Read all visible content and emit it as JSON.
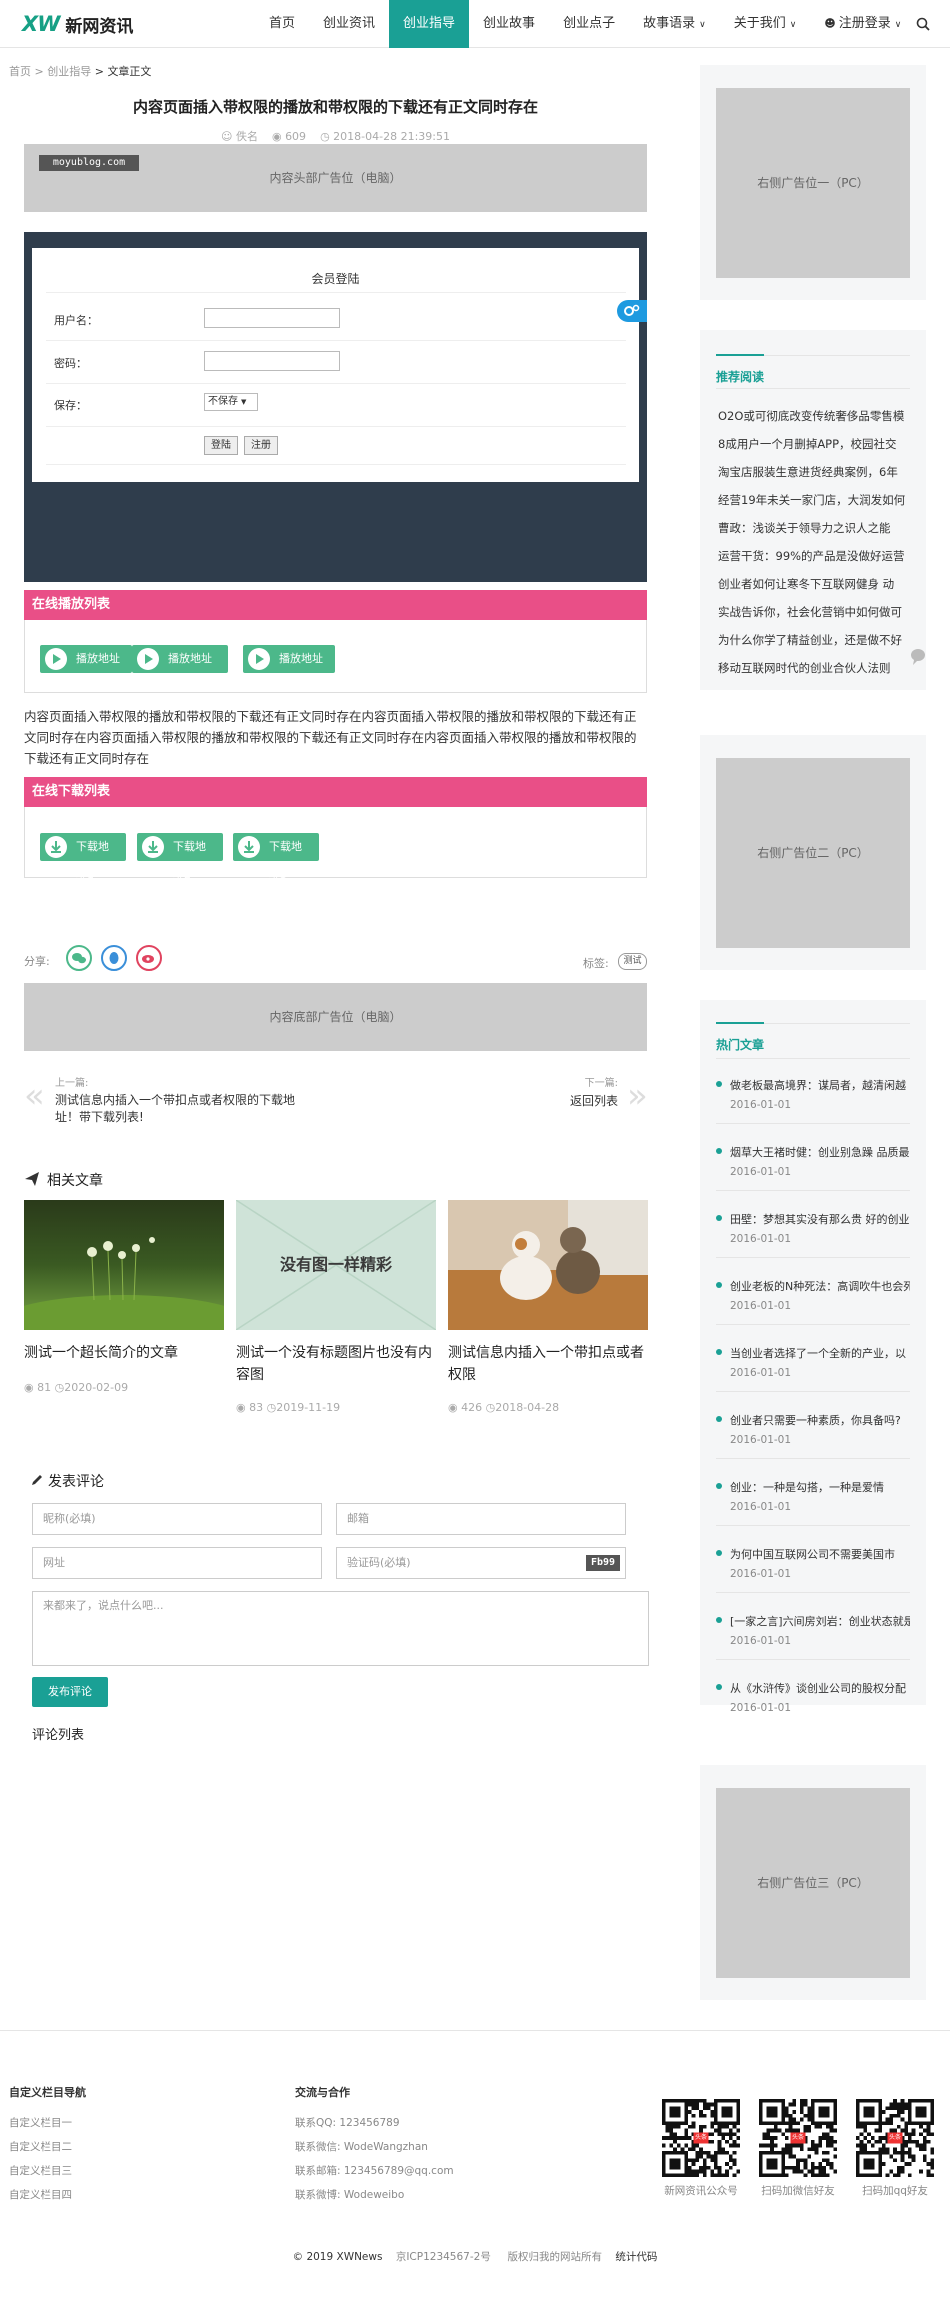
{
  "site": {
    "logo_mark": "XW",
    "logo_text": "新网资讯"
  },
  "nav": [
    {
      "label": "首页"
    },
    {
      "label": "创业资讯"
    },
    {
      "label": "创业指导",
      "active": true
    },
    {
      "label": "创业故事"
    },
    {
      "label": "创业点子"
    },
    {
      "label": "故事语录",
      "has_dropdown": true
    },
    {
      "label": "关于我们",
      "has_dropdown": true
    },
    {
      "label": "注册登录",
      "has_dropdown": true,
      "icon": "user-icon"
    }
  ],
  "breadcrumb": {
    "home": "首页",
    "sep": ">",
    "category": "创业指导",
    "current": "文章正文"
  },
  "article": {
    "title": "内容页面插入带权限的播放和带权限的下载还有正文同时存在",
    "author": "佚名",
    "views": "609",
    "date": "2018-04-28 21:39:51",
    "body": "内容页面插入带权限的播放和带权限的下载还有正文同时存在内容页面插入带权限的播放和带权限的下载还有正文同时存在内容页面插入带权限的播放和带权限的下载还有正文同时存在内容页面插入带权限的播放和带权限的下载还有正文同时存在"
  },
  "ads": {
    "top": "内容头部广告位（电脑）",
    "top_watermark": "moyublog.com",
    "bottom": "内容底部广告位（电脑）",
    "side1": "右侧广告位一（PC）",
    "side2": "右侧广告位二（PC）",
    "side3": "右侧广告位三（PC）"
  },
  "login": {
    "title": "会员登陆",
    "user_label": "用户名：",
    "pass_label": "密码：",
    "save_label": "保存：",
    "save_value": "不保存",
    "login_btn": "登陆",
    "register_btn": "注册"
  },
  "play": {
    "header": "在线播放列表",
    "buttons": [
      "播放地址一",
      "播放地址二",
      "播放地址三"
    ]
  },
  "download": {
    "header": "在线下载列表",
    "buttons": [
      "下载地址1",
      "下载地址2",
      "下载地址3"
    ]
  },
  "share": {
    "label": "分享:",
    "tags_label": "标签:",
    "tag": "测试"
  },
  "prevnext": {
    "prev_label": "上一篇:",
    "prev_title": "测试信息内插入一个带扣点或者权限的下载地址！带下载列表!",
    "next_label": "下一篇:",
    "next_title": "返回列表"
  },
  "related": {
    "heading": "相关文章",
    "items": [
      {
        "title": "测试一个超长简介的文章",
        "views": "81",
        "date": "2020-02-09"
      },
      {
        "title": "测试一个没有标题图片也没有内容图",
        "views": "83",
        "date": "2019-11-19",
        "img_text": "没有图一样精彩"
      },
      {
        "title": "测试信息内插入一个带扣点或者权限",
        "views": "426",
        "date": "2018-04-28"
      }
    ]
  },
  "comment": {
    "heading": "发表评论",
    "name_ph": "昵称(必填)",
    "email_ph": "邮箱",
    "url_ph": "网址",
    "code_ph": "验证码(必填)",
    "captcha": "Fb99",
    "content_ph": "来都来了，说点什么吧...",
    "submit": "发布评论",
    "list_heading": "评论列表"
  },
  "sidebar": {
    "recommend_heading": "推荐阅读",
    "recommend": [
      "O2O或可彻底改变传统奢侈品零售模",
      "8成用户一个月删掉APP，校园社交",
      "淘宝店服装生意进货经典案例，6年",
      "经营19年未关一家门店，大润发如何",
      "曹政：浅谈关于领导力之识人之能",
      "运营干货：99%的产品是没做好运营",
      "创业者如何让寒冬下互联网健身 动",
      "实战告诉你，社会化营销中如何做可",
      "为什么你学了精益创业，还是做不好",
      "移动互联网时代的创业合伙人法则"
    ],
    "hot_heading": "热门文章",
    "hot": [
      {
        "title": "做老板最高境界：谋局者，越清闲越",
        "date": "2016-01-01"
      },
      {
        "title": "烟草大王褚时健：创业别急躁 品质最",
        "date": "2016-01-01"
      },
      {
        "title": "田壁：梦想其实没有那么贵 好的创业",
        "date": "2016-01-01"
      },
      {
        "title": "创业老板的N种死法：高调吹牛也会死",
        "date": "2016-01-01"
      },
      {
        "title": "当创业者选择了一个全新的产业，以",
        "date": "2016-01-01"
      },
      {
        "title": "创业者只需要一种素质，你具备吗?",
        "date": "2016-01-01"
      },
      {
        "title": "创业：一种是勾搭，一种是爱情",
        "date": "2016-01-01"
      },
      {
        "title": "为何中国互联网公司不需要美国市",
        "date": "2016-01-01"
      },
      {
        "title": "[一家之言]六间房刘岩：创业状态就是",
        "date": "2016-01-01"
      },
      {
        "title": "从《水浒传》谈创业公司的股权分配",
        "date": "2016-01-01"
      }
    ]
  },
  "footer": {
    "nav_heading": "自定义栏目导航",
    "nav": [
      "自定义栏目一",
      "自定义栏目二",
      "自定义栏目三",
      "自定义栏目四"
    ],
    "contact_heading": "交流与合作",
    "contact": [
      "联系QQ:  123456789",
      "联系微信:  WodeWangzhan",
      "联系邮箱:  123456789@qq.com",
      "联系微博:  Wodeweibo"
    ],
    "qr_captions": [
      "新网资讯公众号",
      "扫码加微信好友",
      "扫码加qq好友"
    ],
    "qr_badge": "头条",
    "copyright": "© 2019 XWNews",
    "icp": "京ICP1234567-2号",
    "rights": "版权归我的网站所有",
    "stats": "统计代码"
  }
}
